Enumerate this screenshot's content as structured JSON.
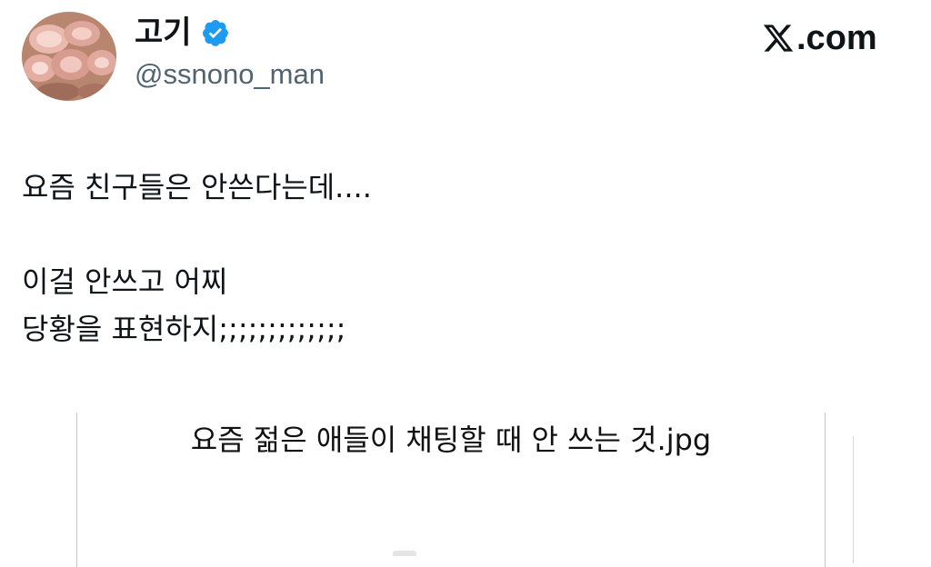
{
  "author": {
    "display_name": "고기",
    "handle": "@ssnono_man",
    "verified": true,
    "avatar_icon": "pork-belly-avatar"
  },
  "brand": {
    "logo_text": ".com",
    "logo_icon": "x-logo-icon"
  },
  "tweet": {
    "text": "요즘 친구들은 안쓴다는데....\n\n이걸 안쓰고 어찌\n당황을 표현하지;;;;;;;;;;;;;"
  },
  "media": {
    "caption": "요즘 젊은 애들이 채팅할 때 안 쓰는 것.jpg"
  },
  "colors": {
    "verified_badge": "#1d9bf0",
    "handle_gray": "#536471",
    "text": "#0f1419"
  }
}
